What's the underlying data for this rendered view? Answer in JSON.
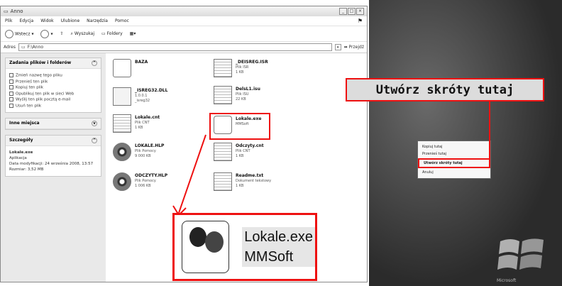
{
  "window": {
    "title": "Anno"
  },
  "menu": [
    "Plik",
    "Edycja",
    "Widok",
    "Ulubione",
    "Narzędzia",
    "Pomoc"
  ],
  "toolbar": {
    "back": "Wstecz",
    "search": "Wyszukaj",
    "folders": "Foldery"
  },
  "address": {
    "label": "Adres",
    "value": "F:\\Anno",
    "go": "Przejdź"
  },
  "tasks": {
    "title": "Zadania plików i folderów",
    "items": [
      "Zmień nazwę tego pliku",
      "Przenieś ten plik",
      "Kopiuj ten plik",
      "Opublikuj ten plik w sieci Web",
      "Wyślij ten plik pocztą e-mail",
      "Usuń ten plik"
    ]
  },
  "other": {
    "title": "Inne miejsca"
  },
  "details": {
    "title": "Szczegóły",
    "name": "Lokale.exe",
    "type": "Aplikacja",
    "modified": "Data modyfikacji: 24 września 2008, 13:57",
    "size": "Rozmiar: 3,52 MB"
  },
  "files": [
    {
      "name": "BAZA",
      "meta": []
    },
    {
      "name": "_ISREG32.DLL",
      "meta": [
        "1.0.0.1",
        "_isreg32"
      ]
    },
    {
      "name": "Lokale.cnt",
      "meta": [
        "Plik CNT",
        "1 KB"
      ]
    },
    {
      "name": "LOKALE.HLP",
      "meta": [
        "Plik Pomocy",
        "9 000 KB"
      ]
    },
    {
      "name": "ODCZYTY.HLP",
      "meta": [
        "Plik Pomocy",
        "1 006 KB"
      ]
    },
    {
      "name": "_DEISREG.ISR",
      "meta": [
        "Plik ISR",
        "1 KB"
      ]
    },
    {
      "name": "DelsL1.isu",
      "meta": [
        "Plik ISU",
        "22 KB"
      ]
    },
    {
      "name": "Lokale.exe",
      "meta": [
        "MMSoft"
      ]
    },
    {
      "name": "Odczyty.cnt",
      "meta": [
        "Plik CNT",
        "1 KB"
      ]
    },
    {
      "name": "Readme.txt",
      "meta": [
        "Dokument tekstowy",
        "1 KB"
      ]
    }
  ],
  "callout": "Utwórz skróty tutaj",
  "context_menu": [
    "Kopiuj tutaj",
    "Przenieś tutaj",
    "Utwórz skróty tutaj",
    "Anuluj"
  ],
  "zoom": {
    "line1": "Lokale.exe",
    "line2": "MMSoft"
  },
  "desktop_text": "Microsoft",
  "accent": "#e11111"
}
